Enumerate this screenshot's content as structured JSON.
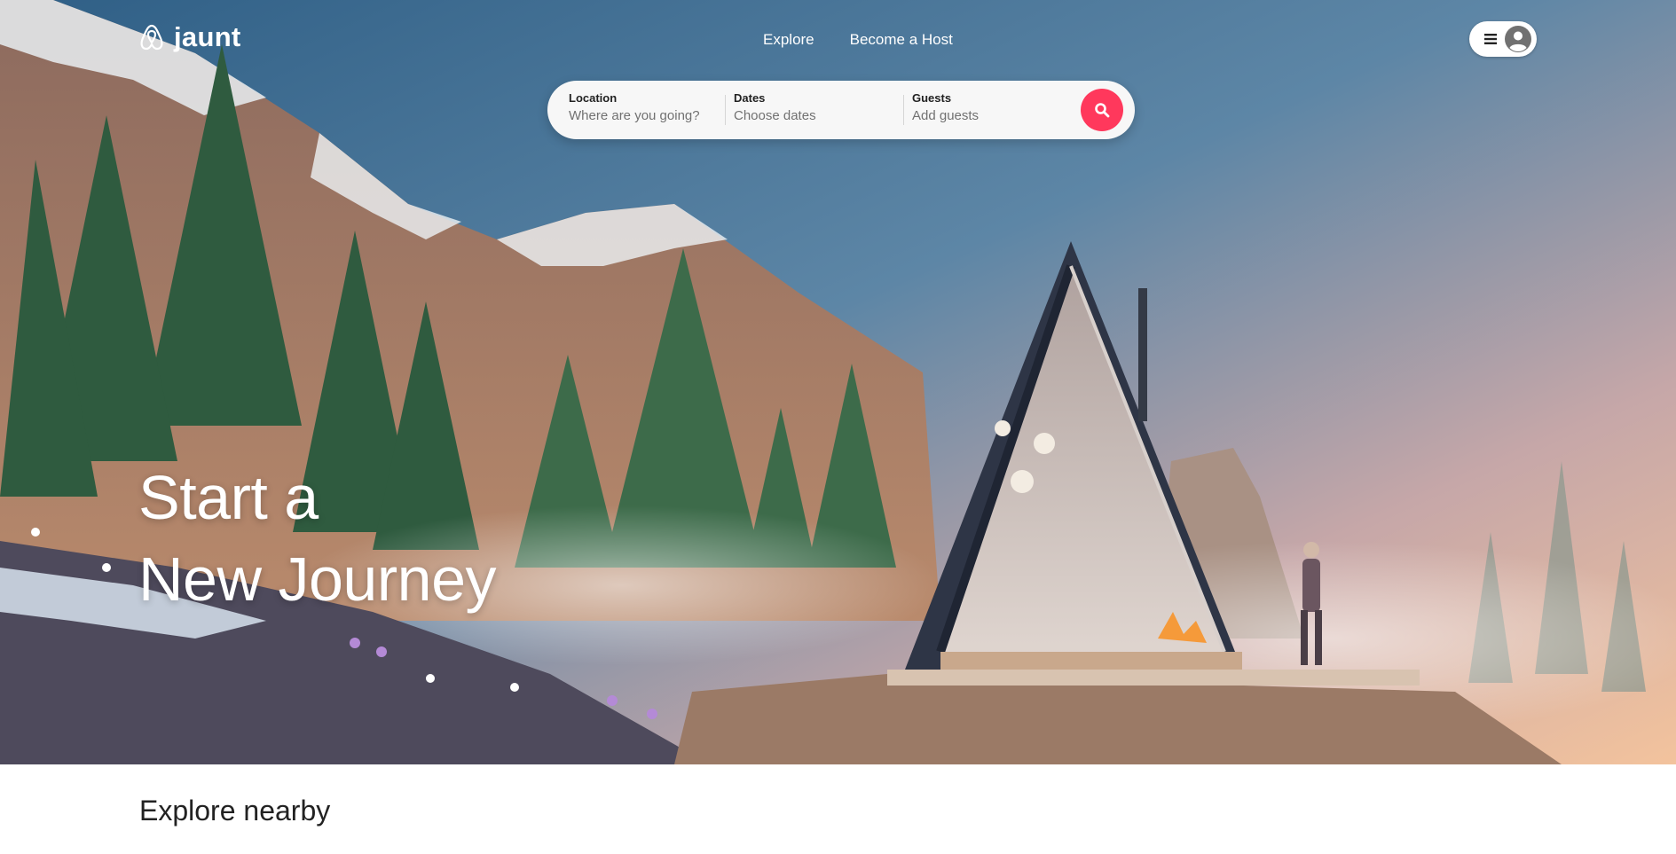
{
  "brand": {
    "name": "jaunt"
  },
  "nav": {
    "explore": "Explore",
    "host": "Become a Host"
  },
  "search": {
    "location": {
      "label": "Location",
      "placeholder": "Where are you going?"
    },
    "dates": {
      "label": "Dates",
      "placeholder": "Choose dates"
    },
    "guests": {
      "label": "Guests",
      "placeholder": "Add guests"
    },
    "button_icon": "search-icon"
  },
  "user_menu": {
    "icons": [
      "hamburger-menu-icon",
      "user-avatar-icon"
    ]
  },
  "hero": {
    "line1": "Start a",
    "line2": "New Journey"
  },
  "sections": {
    "nearby_title": "Explore nearby"
  },
  "colors": {
    "accent": "#ff385c",
    "searchbar_bg": "#f7f7f7",
    "text_dark": "#222222"
  }
}
